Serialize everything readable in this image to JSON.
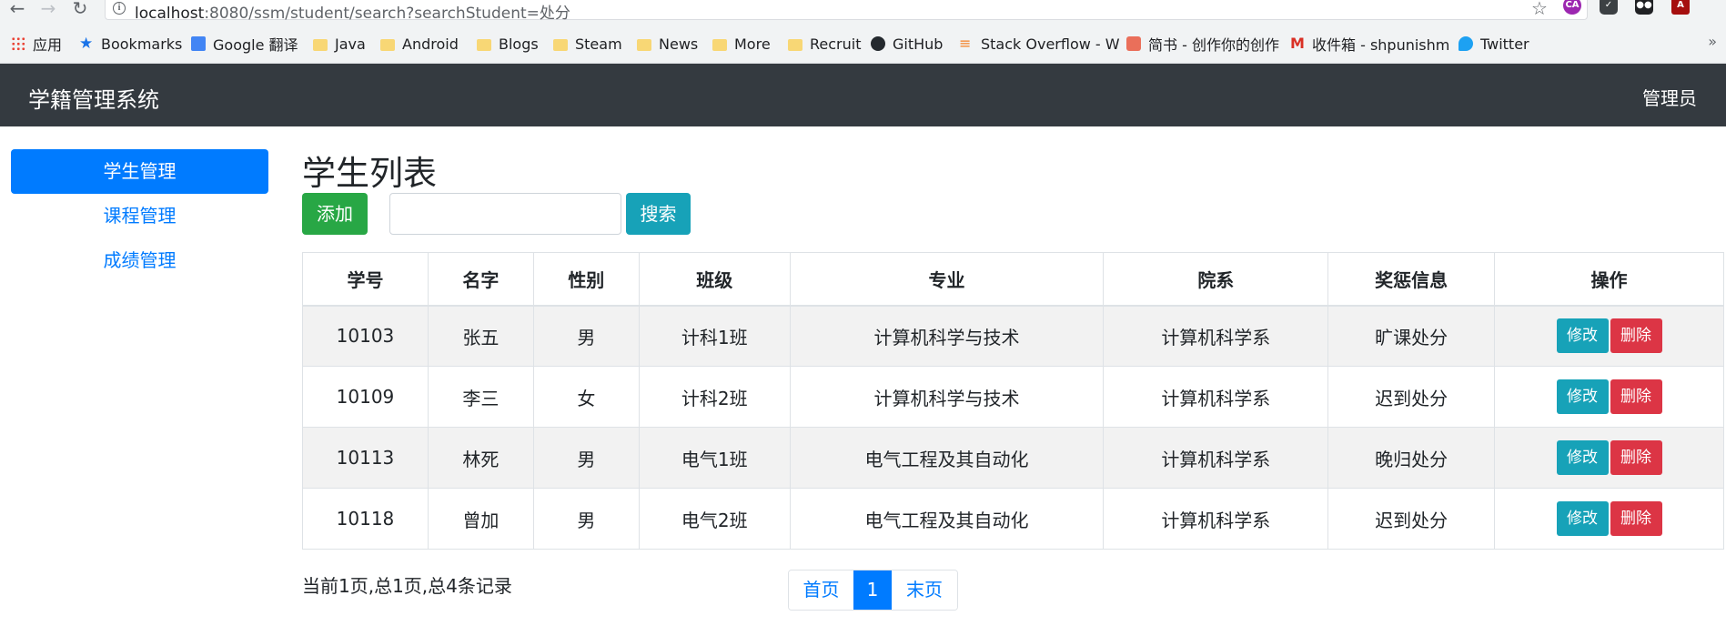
{
  "browser": {
    "url_host": "localhost",
    "url_path": ":8080/ssm/student/search?searchStudent=处分",
    "extensions": [
      "CA",
      "pocket",
      "tampermonkey",
      "A"
    ],
    "bookmarks": [
      {
        "label": "应用",
        "icon": "apps-grid-icon"
      },
      {
        "label": "Bookmarks",
        "icon": "star-icon"
      },
      {
        "label": "Google 翻译",
        "icon": "google-translate-icon"
      },
      {
        "label": "Java",
        "icon": "folder-icon"
      },
      {
        "label": "Android",
        "icon": "folder-icon"
      },
      {
        "label": "Blogs",
        "icon": "folder-icon"
      },
      {
        "label": "Steam",
        "icon": "folder-icon"
      },
      {
        "label": "News",
        "icon": "folder-icon"
      },
      {
        "label": "More",
        "icon": "folder-icon"
      },
      {
        "label": "Recruit",
        "icon": "folder-icon"
      },
      {
        "label": "GitHub",
        "icon": "github-icon"
      },
      {
        "label": "Stack Overflow - W",
        "icon": "stackoverflow-icon"
      },
      {
        "label": "简书 - 创作你的创作",
        "icon": "jianshu-icon"
      },
      {
        "label": "收件箱 - shpunishm",
        "icon": "gmail-icon"
      },
      {
        "label": "Twitter",
        "icon": "twitter-icon"
      }
    ],
    "more": "»"
  },
  "navbar": {
    "brand": "学籍管理系统",
    "user": "管理员"
  },
  "sidebar": {
    "items": [
      {
        "label": "学生管理",
        "active": true
      },
      {
        "label": "课程管理",
        "active": false
      },
      {
        "label": "成绩管理",
        "active": false
      }
    ]
  },
  "main": {
    "title": "学生列表",
    "add_label": "添加",
    "search_value": "",
    "search_label": "搜索",
    "table": {
      "headers": [
        "学号",
        "名字",
        "性别",
        "班级",
        "专业",
        "院系",
        "奖惩信息",
        "操作"
      ],
      "rows": [
        [
          "10103",
          "张五",
          "男",
          "计科1班",
          "计算机科学与技术",
          "计算机科学系",
          "旷课处分"
        ],
        [
          "10109",
          "李三",
          "女",
          "计科2班",
          "计算机科学与技术",
          "计算机科学系",
          "迟到处分"
        ],
        [
          "10113",
          "林死",
          "男",
          "电气1班",
          "电气工程及其自动化",
          "计算机科学系",
          "晚归处分"
        ],
        [
          "10118",
          "曾加",
          "男",
          "电气2班",
          "电气工程及其自动化",
          "计算机科学系",
          "迟到处分"
        ]
      ],
      "edit_label": "修改",
      "delete_label": "删除"
    },
    "pagination": {
      "info": "当前1页,总1页,总4条记录",
      "first": "首页",
      "current": "1",
      "last": "末页"
    }
  },
  "colors": {
    "primary": "#007bff",
    "success": "#28a745",
    "info": "#17a2b8",
    "danger": "#dc3545",
    "navbar": "#343a40"
  }
}
